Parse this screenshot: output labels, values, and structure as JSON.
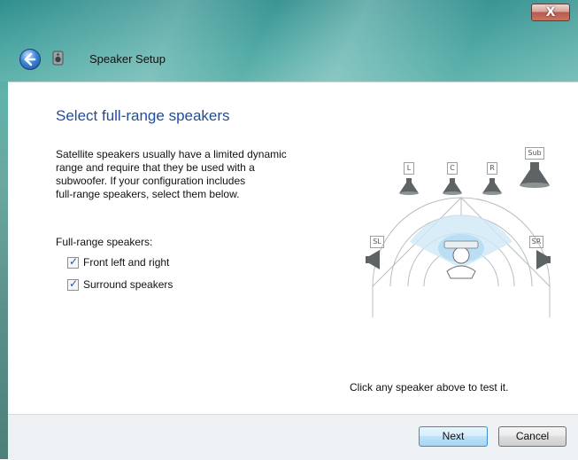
{
  "window": {
    "title": "Speaker Setup",
    "close_glyph": "X"
  },
  "page": {
    "heading": "Select full-range speakers",
    "description": "Satellite speakers usually have a limited dynamic\nrange and require that they be used with a\nsubwoofer.  If your configuration includes\nfull-range speakers, select them below.",
    "fullrange_label": "Full-range speakers:",
    "options": [
      {
        "label": "Front left and right",
        "checked": true
      },
      {
        "label": "Surround speakers",
        "checked": true
      }
    ],
    "test_hint": "Click any speaker above to test it."
  },
  "diagram": {
    "speakers": [
      {
        "label": "L",
        "icon": "front-left-speaker-icon"
      },
      {
        "label": "C",
        "icon": "center-speaker-icon"
      },
      {
        "label": "R",
        "icon": "front-right-speaker-icon"
      },
      {
        "label": "Sub",
        "icon": "subwoofer-icon"
      },
      {
        "label": "SL",
        "icon": "surround-left-speaker-icon"
      },
      {
        "label": "SR",
        "icon": "surround-right-speaker-icon"
      }
    ]
  },
  "buttons": {
    "next": "Next",
    "cancel": "Cancel"
  },
  "colors": {
    "heading": "#1f4e9c",
    "frame": "#4aa7a2",
    "next_border": "#3a8bd4"
  }
}
